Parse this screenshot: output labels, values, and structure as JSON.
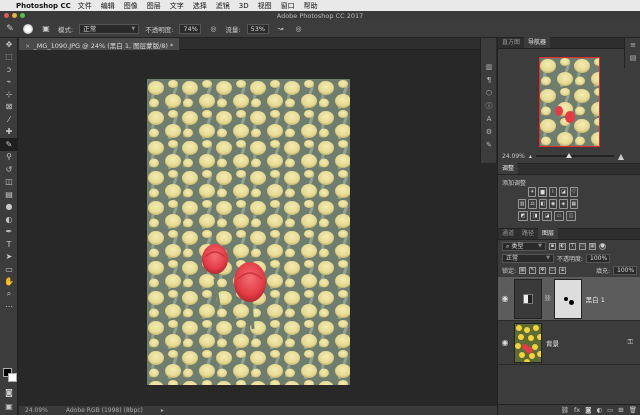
{
  "menubar": {
    "apple": "",
    "app_name": "Photoshop CC",
    "items": [
      "文件",
      "编辑",
      "图像",
      "图层",
      "文字",
      "选择",
      "滤镜",
      "3D",
      "视图",
      "窗口",
      "帮助"
    ]
  },
  "window": {
    "title": "Adobe Photoshop CC 2017"
  },
  "options": {
    "mode_label": "模式:",
    "mode_value": "正常",
    "opacity_label": "不透明度:",
    "opacity_value": "74%",
    "flow_label": "流量:",
    "flow_value": "53%"
  },
  "document": {
    "tab_close": "×",
    "tab_title": "_MG_1090.JPG @ 24% (黑白 1, 图层蒙版/8) *"
  },
  "status": {
    "zoom": "24.09%",
    "profile": "Adobe RGB (1998) (8bpc)"
  },
  "panels": {
    "nav_tabs": [
      "直方图",
      "导航器"
    ],
    "nav_zoom": "24.09%",
    "adj_tabs": [
      "调整"
    ],
    "adj_add": "添加调整",
    "layer_tabs": [
      "通道",
      "路径",
      "图层"
    ],
    "kind_filter": "类型",
    "blend_mode": "正常",
    "opacity_label": "不透明度:",
    "opacity_value": "100%",
    "lock_label": "锁定:",
    "fill_label": "填充:",
    "fill_value": "100%",
    "layers": [
      {
        "name": "黑白 1"
      },
      {
        "name": "背景"
      }
    ]
  },
  "colors": {
    "tulip_yellow": "#e8dc8c",
    "tulip_red": "#e8414c",
    "stem": "#6e7e6a",
    "accent": "#4aa3df"
  }
}
